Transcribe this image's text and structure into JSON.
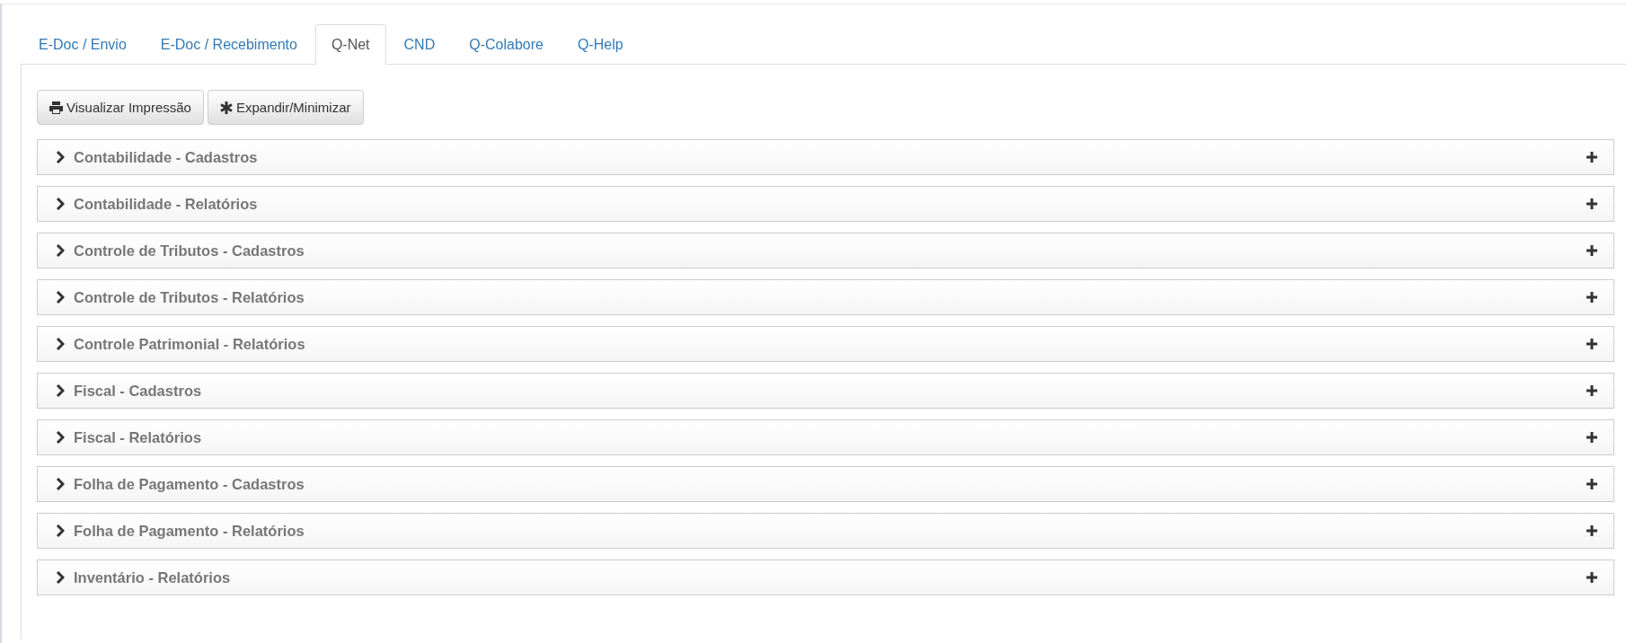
{
  "tabs": [
    {
      "label": "E-Doc / Envio",
      "selected": false
    },
    {
      "label": "E-Doc / Recebimento",
      "selected": false
    },
    {
      "label": "Q-Net",
      "selected": true
    },
    {
      "label": "CND",
      "selected": false
    },
    {
      "label": "Q-Colabore",
      "selected": false
    },
    {
      "label": "Q-Help",
      "selected": false
    }
  ],
  "toolbar": [
    {
      "label": "Visualizar Impressão",
      "kind": "print"
    },
    {
      "label": "Expandir/Minimizar",
      "kind": "asterisk"
    }
  ],
  "panels": [
    {
      "title": "Contabilidade - Cadastros",
      "expanded": false
    },
    {
      "title": "Contabilidade - Relatórios",
      "expanded": false
    },
    {
      "title": "Controle de Tributos - Cadastros",
      "expanded": false
    },
    {
      "title": "Controle de Tributos - Relatórios",
      "expanded": false
    },
    {
      "title": "Controle Patrimonial - Relatórios",
      "expanded": false
    },
    {
      "title": "Fiscal - Cadastros",
      "expanded": false
    },
    {
      "title": "Fiscal - Relatórios",
      "expanded": false
    },
    {
      "title": "Folha de Pagamento - Cadastros",
      "expanded": false
    },
    {
      "title": "Folha de Pagamento - Relatórios",
      "expanded": false
    },
    {
      "title": "Inventário - Relatórios",
      "expanded": false
    }
  ]
}
